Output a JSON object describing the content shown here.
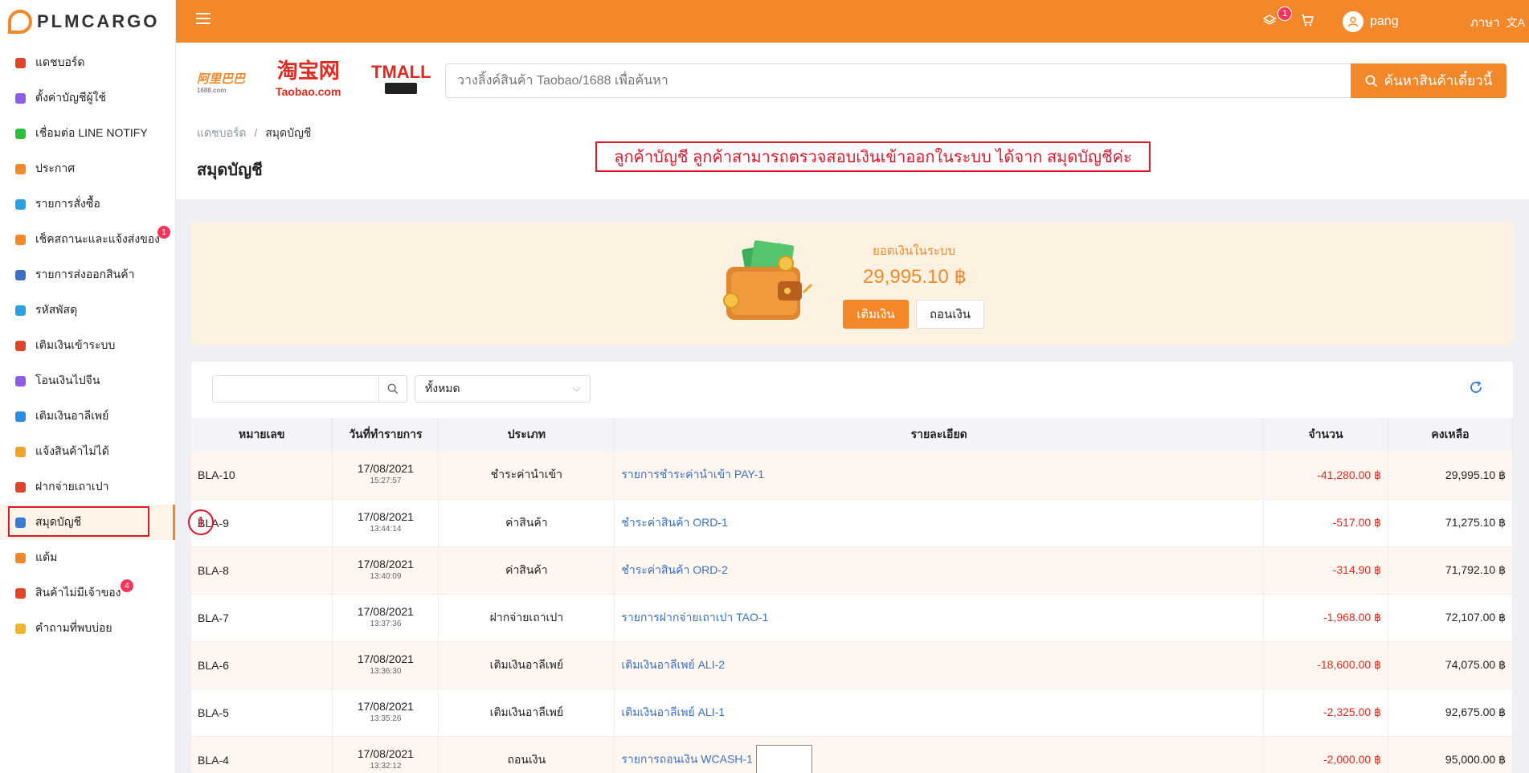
{
  "brand": {
    "logo_text": "PLMCARGO"
  },
  "sidebar": {
    "items": [
      {
        "label": "แดชบอร์ด",
        "icon": "chart-icon",
        "color": "#e0452a"
      },
      {
        "label": "ตั้งค่าบัญชีผู้ใช้",
        "icon": "user-settings-icon",
        "color": "#8e5ce6"
      },
      {
        "label": "เชื่อมต่อ LINE NOTIFY",
        "icon": "line-icon",
        "color": "#2bbf3a"
      },
      {
        "label": "ประกาศ",
        "icon": "megaphone-icon",
        "color": "#f2882a"
      },
      {
        "label": "รายการสั่งซื้อ",
        "icon": "cart-icon",
        "color": "#2aa0e0"
      },
      {
        "label": "เช็คสถานะและแจ้งส่งของ",
        "icon": "truck-icon",
        "color": "#f2882a",
        "badge": "1"
      },
      {
        "label": "รายการส่งออกสินค้า",
        "icon": "dolly-icon",
        "color": "#3a6fc4"
      },
      {
        "label": "รหัสพัสดุ",
        "icon": "box-icon",
        "color": "#2aa0e0"
      },
      {
        "label": "เติมเงินเข้าระบบ",
        "icon": "piggy-bank-icon",
        "color": "#e0452a"
      },
      {
        "label": "โอนเงินไปจีน",
        "icon": "yuan-icon",
        "color": "#8e5ce6"
      },
      {
        "label": "เติมเงินอาลีเพย์",
        "icon": "alipay-icon",
        "color": "#2a8fe0"
      },
      {
        "label": "แจ้งสินค้าไม่ได้",
        "icon": "no-box-icon",
        "color": "#f2a22a"
      },
      {
        "label": "ฝากจ่ายเถาเปา",
        "icon": "taobao-icon",
        "color": "#e0452a"
      },
      {
        "label": "สมุดบัญชี",
        "icon": "wallet-icon",
        "color": "#3a7bd5",
        "active": true
      },
      {
        "label": "แต้ม",
        "icon": "medal-icon",
        "color": "#f2882a"
      },
      {
        "label": "สินค้าไม่มีเจ้าของ",
        "icon": "search-box-icon",
        "color": "#e0452a",
        "badge": "4"
      },
      {
        "label": "คำถามที่พบบ่อย",
        "icon": "question-icon",
        "color": "#f2b52a"
      }
    ]
  },
  "topbar": {
    "cart_badge": "1",
    "user_name": "pang",
    "language_label": "ภาษา"
  },
  "header": {
    "search_placeholder": "วางลิ้งค์สินค้า Taobao/1688 เพื่อค้นหา",
    "search_button": "ค้นหาสินค้าเดี๋ยวนี้",
    "breadcrumb_home": "แดชบอร์ด",
    "breadcrumb_sep": "/",
    "breadcrumb_current": "สมุดบัญชี",
    "page_title": "สมุดบัญชี",
    "annotation": "ลูกค้าบัญชี ลูกค้าสามารถตรวจสอบเงินเข้าออกในระบบ ได้จาก สมุดบัญชีค่ะ",
    "marker": "1"
  },
  "logos": {
    "l1688": "阿里巴巴",
    "l1688_sub": "1688.com",
    "taobao": "淘宝网",
    "taobao_sub": "Taobao.com",
    "tmall": "TMALL"
  },
  "balance": {
    "label": "ยอดเงินในระบบ",
    "value": "29,995.10 ฿",
    "topup": "เติมเงิน",
    "withdraw": "ถอนเงิน"
  },
  "filter": {
    "select_value": "ทั้งหมด"
  },
  "table": {
    "headers": [
      "หมายเลข",
      "วันที่ทำรายการ",
      "ประเภท",
      "รายละเอียด",
      "จำนวน",
      "คงเหลือ"
    ],
    "rows": [
      {
        "no": "BLA-10",
        "date": "17/08/2021",
        "time": "15:27:57",
        "type": "ชำระค่านำเข้า",
        "detail": "รายการชำระค่านำเข้า PAY-1",
        "amount": "-41,280.00 ฿",
        "remain": "29,995.10 ฿"
      },
      {
        "no": "BLA-9",
        "date": "17/08/2021",
        "time": "13:44:14",
        "type": "ค่าสินค้า",
        "detail": "ชำระค่าสินค้า ORD-1",
        "amount": "-517.00 ฿",
        "remain": "71,275.10 ฿"
      },
      {
        "no": "BLA-8",
        "date": "17/08/2021",
        "time": "13:40:09",
        "type": "ค่าสินค้า",
        "detail": "ชำระค่าสินค้า ORD-2",
        "amount": "-314.90 ฿",
        "remain": "71,792.10 ฿"
      },
      {
        "no": "BLA-7",
        "date": "17/08/2021",
        "time": "13:37:36",
        "type": "ฝากจ่ายเถาเปา",
        "detail": "รายการฝากจ่ายเถาเปา TAO-1",
        "amount": "-1,968.00 ฿",
        "remain": "72,107.00 ฿"
      },
      {
        "no": "BLA-6",
        "date": "17/08/2021",
        "time": "13:36:30",
        "type": "เติมเงินอาลีเพย์",
        "detail": "เติมเงินอาลีเพย์ ALI-2",
        "amount": "-18,600.00 ฿",
        "remain": "74,075.00 ฿"
      },
      {
        "no": "BLA-5",
        "date": "17/08/2021",
        "time": "13:35:26",
        "type": "เติมเงินอาลีเพย์",
        "detail": "เติมเงินอาลีเพย์ ALI-1",
        "amount": "-2,325.00 ฿",
        "remain": "92,675.00 ฿"
      },
      {
        "no": "BLA-4",
        "date": "17/08/2021",
        "time": "13:32:12",
        "type": "ถอนเงิน",
        "detail": "รายการถอนเงิน WCASH-1",
        "amount": "-2,000.00 ฿",
        "remain": "95,000.00 ฿",
        "thumb": true
      }
    ]
  },
  "colors": {
    "accent": "#f2882a",
    "danger": "#e0162b",
    "link": "#3a6fc4"
  }
}
